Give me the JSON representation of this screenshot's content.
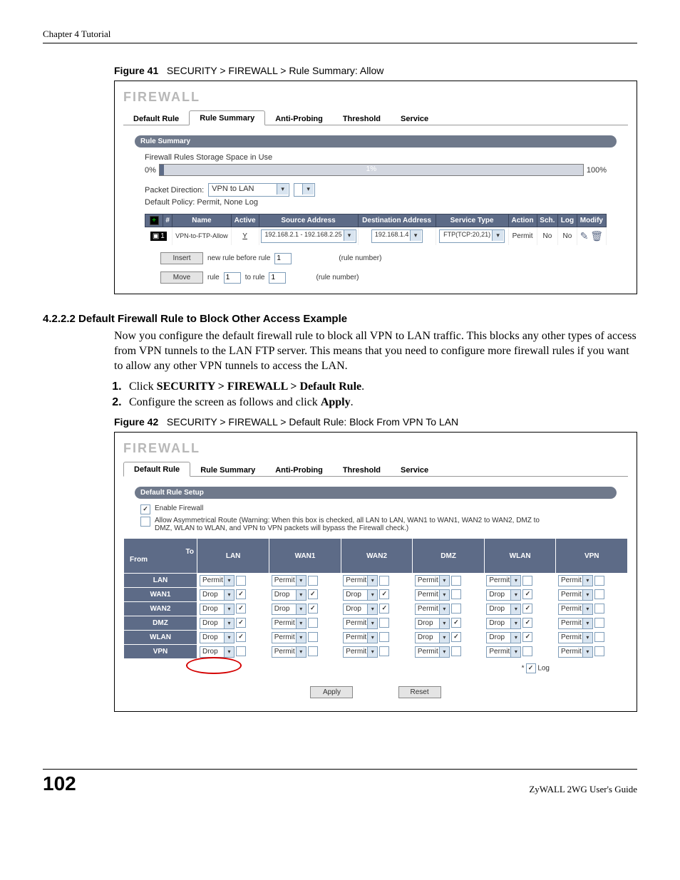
{
  "chapter": "Chapter 4 Tutorial",
  "fig41": {
    "caption_label": "Figure 41",
    "caption_text": "SECURITY > FIREWALL > Rule Summary: Allow",
    "title": "FIREWALL",
    "tabs": [
      "Default Rule",
      "Rule Summary",
      "Anti-Probing",
      "Threshold",
      "Service"
    ],
    "section_bar": "Rule Summary",
    "storage_label": "Firewall Rules Storage Space in Use",
    "pct0": "0%",
    "pct1": "1%",
    "pct100": "100%",
    "direction_label": "Packet Direction:",
    "direction_value": "VPN to LAN",
    "default_policy": "Default Policy: Permit, None Log",
    "headers": [
      "#",
      "Name",
      "Active",
      "Source Address",
      "Destination Address",
      "Service Type",
      "Action",
      "Sch.",
      "Log",
      "Modify"
    ],
    "row": {
      "num": "1",
      "name": "VPN-to-FTP-Allow",
      "active": "Y",
      "src": "192.168.2.1 - 192.168.2.25",
      "dst": "192.168.1.4",
      "svc": "FTP(TCP:20,21)",
      "action": "Permit",
      "sch": "No",
      "log": "No"
    },
    "insert_btn": "Insert",
    "insert_text1": "new rule before rule",
    "insert_val": "1",
    "insert_text2": "(rule number)",
    "move_btn": "Move",
    "move_text1": "rule",
    "move_val1": "1",
    "move_text2": "to rule",
    "move_val2": "1",
    "move_text3": "(rule number)"
  },
  "section_4222": {
    "heading": "4.2.2.2  Default Firewall Rule to Block Other Access Example",
    "p1": "Now you configure the default firewall rule to block all VPN to LAN traffic. This blocks any other types of access from VPN tunnels to the LAN FTP server. This means that you need to configure more firewall rules if you want to allow any other VPN tunnels to access the LAN.",
    "step1a": "Click ",
    "step1b": "SECURITY > FIREWALL > Default Rule",
    "step1c": ".",
    "step2a": "Configure the screen as follows and click ",
    "step2b": "Apply",
    "step2c": "."
  },
  "fig42": {
    "caption_label": "Figure 42",
    "caption_text": "SECURITY > FIREWALL > Default Rule: Block From VPN To LAN",
    "title": "FIREWALL",
    "tabs": [
      "Default Rule",
      "Rule Summary",
      "Anti-Probing",
      "Threshold",
      "Service"
    ],
    "section_bar": "Default Rule Setup",
    "enable_label": "Enable Firewall",
    "asym_label": "Allow Asymmetrical Route (Warning: When this box is checked, all LAN to LAN, WAN1 to WAN1, WAN2 to WAN2, DMZ to DMZ, WLAN to WLAN, and VPN to VPN packets will bypass the Firewall check.)",
    "corner_to": "To",
    "corner_from": "From",
    "cols": [
      "LAN",
      "WAN1",
      "WAN2",
      "DMZ",
      "WLAN",
      "VPN"
    ],
    "rows": [
      {
        "name": "LAN",
        "cells": [
          [
            "Permit",
            false
          ],
          [
            "Permit",
            false
          ],
          [
            "Permit",
            false
          ],
          [
            "Permit",
            false
          ],
          [
            "Permit",
            false
          ],
          [
            "Permit",
            false
          ]
        ]
      },
      {
        "name": "WAN1",
        "cells": [
          [
            "Drop",
            true
          ],
          [
            "Drop",
            true
          ],
          [
            "Drop",
            true
          ],
          [
            "Permit",
            false
          ],
          [
            "Drop",
            true
          ],
          [
            "Permit",
            false
          ]
        ]
      },
      {
        "name": "WAN2",
        "cells": [
          [
            "Drop",
            true
          ],
          [
            "Drop",
            true
          ],
          [
            "Drop",
            true
          ],
          [
            "Permit",
            false
          ],
          [
            "Drop",
            true
          ],
          [
            "Permit",
            false
          ]
        ]
      },
      {
        "name": "DMZ",
        "cells": [
          [
            "Drop",
            true
          ],
          [
            "Permit",
            false
          ],
          [
            "Permit",
            false
          ],
          [
            "Drop",
            true
          ],
          [
            "Drop",
            true
          ],
          [
            "Permit",
            false
          ]
        ]
      },
      {
        "name": "WLAN",
        "cells": [
          [
            "Drop",
            true
          ],
          [
            "Permit",
            false
          ],
          [
            "Permit",
            false
          ],
          [
            "Drop",
            true
          ],
          [
            "Drop",
            true
          ],
          [
            "Permit",
            false
          ]
        ]
      },
      {
        "name": "VPN",
        "cells": [
          [
            "Drop",
            false
          ],
          [
            "Permit",
            false
          ],
          [
            "Permit",
            false
          ],
          [
            "Permit",
            false
          ],
          [
            "Permit",
            false
          ],
          [
            "Permit",
            false
          ]
        ]
      }
    ],
    "log_label": "Log",
    "apply_btn": "Apply",
    "reset_btn": "Reset"
  },
  "footer": {
    "page": "102",
    "guide": "ZyWALL 2WG User's Guide"
  }
}
